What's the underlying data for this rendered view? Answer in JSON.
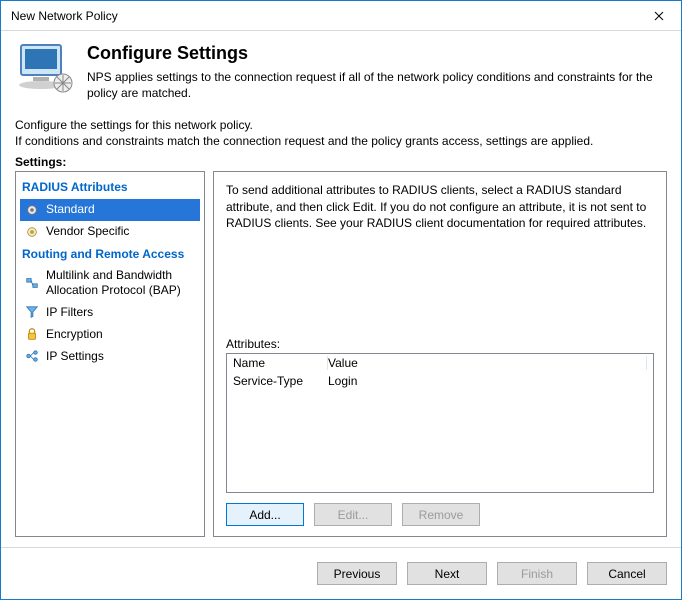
{
  "window": {
    "title": "New Network Policy"
  },
  "header": {
    "title": "Configure Settings",
    "description": "NPS applies settings to the connection request if all of the network policy conditions and constraints for the policy are matched."
  },
  "instructions": {
    "line1": "Configure the settings for this network policy.",
    "line2": "If conditions and constraints match the connection request and the policy grants access, settings are applied."
  },
  "settings_label": "Settings:",
  "sidebar": {
    "sections": [
      {
        "title": "RADIUS Attributes",
        "items": [
          {
            "label": "Standard",
            "selected": true
          },
          {
            "label": "Vendor Specific",
            "selected": false
          }
        ]
      },
      {
        "title": "Routing and Remote Access",
        "items": [
          {
            "label": "Multilink and Bandwidth Allocation Protocol (BAP)",
            "selected": false
          },
          {
            "label": "IP Filters",
            "selected": false
          },
          {
            "label": "Encryption",
            "selected": false
          },
          {
            "label": "IP Settings",
            "selected": false
          }
        ]
      }
    ]
  },
  "content": {
    "description": "To send additional attributes to RADIUS clients, select a RADIUS standard attribute, and then click Edit. If you do not configure an attribute, it is not sent to RADIUS clients. See your RADIUS client documentation for required attributes.",
    "attributes_label": "Attributes:",
    "table": {
      "headers": {
        "name": "Name",
        "value": "Value"
      },
      "rows": [
        {
          "name": "Service-Type",
          "value": "Login"
        }
      ]
    },
    "buttons": {
      "add": "Add...",
      "edit": "Edit...",
      "remove": "Remove"
    }
  },
  "footer": {
    "previous": "Previous",
    "next": "Next",
    "finish": "Finish",
    "cancel": "Cancel"
  }
}
